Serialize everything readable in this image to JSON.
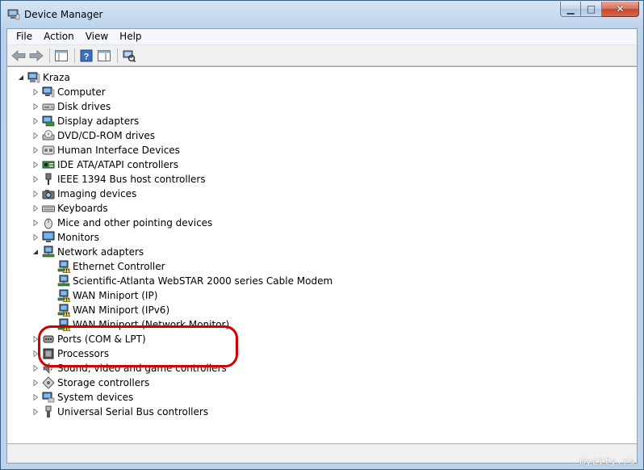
{
  "window": {
    "title": "Device Manager"
  },
  "menu": [
    "File",
    "Action",
    "View",
    "Help"
  ],
  "tree": {
    "root": "Kraza",
    "categories": [
      {
        "label": "Computer",
        "icon": "computer-icon"
      },
      {
        "label": "Disk drives",
        "icon": "disk-drive-icon"
      },
      {
        "label": "Display adapters",
        "icon": "display-adapter-icon"
      },
      {
        "label": "DVD/CD-ROM drives",
        "icon": "dvd-drive-icon"
      },
      {
        "label": "Human Interface Devices",
        "icon": "hid-icon"
      },
      {
        "label": "IDE ATA/ATAPI controllers",
        "icon": "ide-controller-icon"
      },
      {
        "label": "IEEE 1394 Bus host controllers",
        "icon": "ieee1394-icon"
      },
      {
        "label": "Imaging devices",
        "icon": "camera-icon"
      },
      {
        "label": "Keyboards",
        "icon": "keyboard-icon"
      },
      {
        "label": "Mice and other pointing devices",
        "icon": "mouse-icon"
      },
      {
        "label": "Monitors",
        "icon": "monitor-icon"
      },
      {
        "label": "Network adapters",
        "icon": "network-adapter-icon",
        "expanded": true
      },
      {
        "label": "Ports (COM & LPT)",
        "icon": "port-icon"
      },
      {
        "label": "Processors",
        "icon": "processor-icon"
      },
      {
        "label": "Sound, video and game controllers",
        "icon": "sound-icon"
      },
      {
        "label": "Storage controllers",
        "icon": "storage-icon"
      },
      {
        "label": "System devices",
        "icon": "system-device-icon"
      },
      {
        "label": "Universal Serial Bus controllers",
        "icon": "usb-icon"
      }
    ],
    "network_children": [
      {
        "label": "Ethernet Controller",
        "warning": true
      },
      {
        "label": "Scientific-Atlanta WebSTAR 2000 series Cable Modem",
        "warning": false
      },
      {
        "label": "WAN Miniport (IP)",
        "warning": true
      },
      {
        "label": "WAN Miniport (IPv6)",
        "warning": true
      },
      {
        "label": "WAN Miniport (Network Monitor)",
        "warning": true
      }
    ]
  },
  "annotation": {
    "color": "#d40000"
  },
  "watermark": "mycity.rs"
}
